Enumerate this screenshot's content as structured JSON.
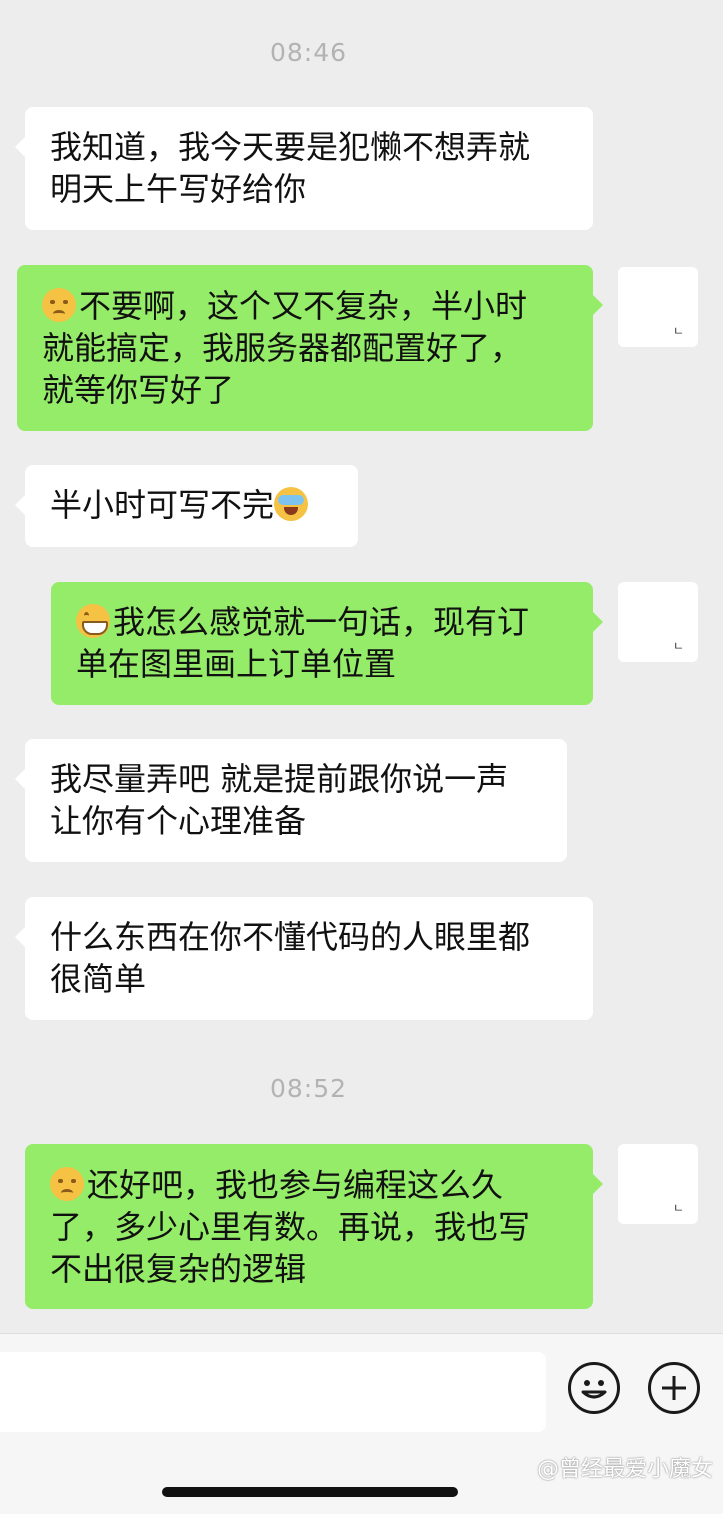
{
  "timestamps": [
    "08:46",
    "08:52"
  ],
  "messages": [
    {
      "side": "in",
      "lines": [
        "我知道，我今天要是犯懒不想弄就",
        "明天上午写好给你"
      ]
    },
    {
      "side": "out",
      "emoji": "sad-face",
      "lines": [
        "不要啊，这个又不复杂，半小时",
        "就能搞定，我服务器都配置好了，",
        "就等你写好了"
      ]
    },
    {
      "side": "in",
      "emoji_after": "crying-laughing-face",
      "lines": [
        "半小时可写不完"
      ]
    },
    {
      "side": "out",
      "emoji": "grinning-face",
      "lines": [
        "我怎么感觉就一句话，现有订",
        "单在图里画上订单位置"
      ]
    },
    {
      "side": "in",
      "lines": [
        "我尽量弄吧 就是提前跟你说一声",
        "让你有个心理准备"
      ]
    },
    {
      "side": "in",
      "lines": [
        "什么东西在你不懂代码的人眼里都",
        "很简单"
      ]
    },
    {
      "side": "out",
      "emoji": "sad-face",
      "lines": [
        "还好吧，我也参与编程这么久",
        "了，多少心里有数。再说，我也写",
        "不出很复杂的逻辑"
      ]
    }
  ],
  "avatar_mark": "ㄴ",
  "input": {
    "placeholder": ""
  },
  "toolbar": {
    "emoji_icon": "smiley-icon",
    "add_icon": "plus-icon"
  },
  "watermark": "@曾经最爱小魔女",
  "colors": {
    "background": "#ededed",
    "incoming": "#ffffff",
    "outgoing": "#95ec69"
  }
}
